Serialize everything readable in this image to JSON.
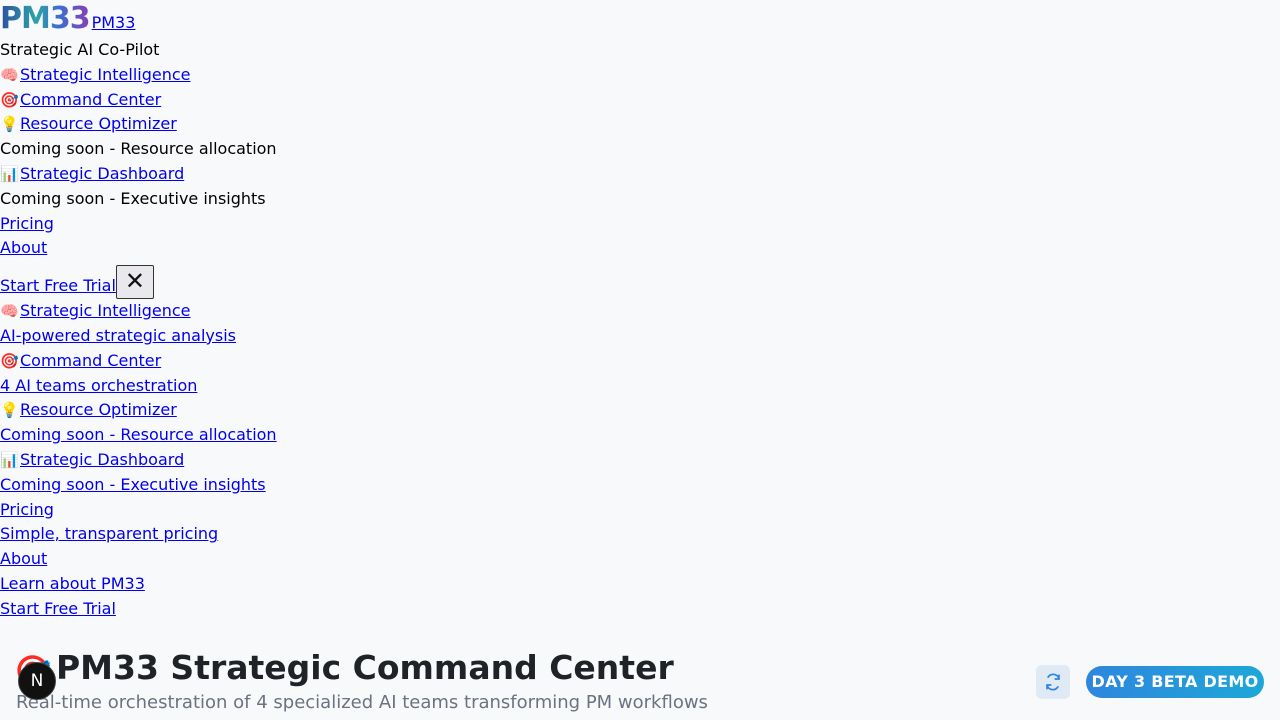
{
  "brand": {
    "logo_text": "PM33",
    "link_label": "PM33",
    "tagline": "Strategic AI Co-Pilot"
  },
  "nav_primary": [
    {
      "icon": "🧠",
      "label": "Strategic Intelligence"
    },
    {
      "icon": "🎯",
      "label": "Command Center"
    },
    {
      "icon": "💡",
      "label": "Resource Optimizer",
      "note": "Coming soon - Resource allocation"
    },
    {
      "icon": "📊",
      "label": "Strategic Dashboard",
      "note": "Coming soon - Executive insights"
    }
  ],
  "nav_links": {
    "pricing": "Pricing",
    "about": "About",
    "trial": "Start Free Trial",
    "close": "✕"
  },
  "nav_mobile": [
    {
      "icon": "🧠",
      "label": "Strategic Intelligence",
      "desc": "AI-powered strategic analysis"
    },
    {
      "icon": "🎯",
      "label": "Command Center",
      "desc": "4 AI teams orchestration"
    },
    {
      "icon": "💡",
      "label": "Resource Optimizer",
      "desc": "Coming soon - Resource allocation"
    },
    {
      "icon": "📊",
      "label": "Strategic Dashboard",
      "desc": "Coming soon - Executive insights"
    },
    {
      "label": "Pricing",
      "desc": "Simple, transparent pricing"
    },
    {
      "label": "About",
      "desc": "Learn about PM33"
    }
  ],
  "mobile_trial": "Start Free Trial",
  "hero": {
    "icon": "🎯",
    "title": "PM33 Strategic Command Center",
    "subtitle": "Real-time orchestration of 4 specialized AI teams transforming PM workflows",
    "badge": "DAY 3 BETA DEMO"
  },
  "dev_badge": "N",
  "colors": {
    "link": "#0000ee",
    "badge_start": "#2e86de",
    "badge_end": "#1ea7d8",
    "background": "#f8f9fb"
  }
}
